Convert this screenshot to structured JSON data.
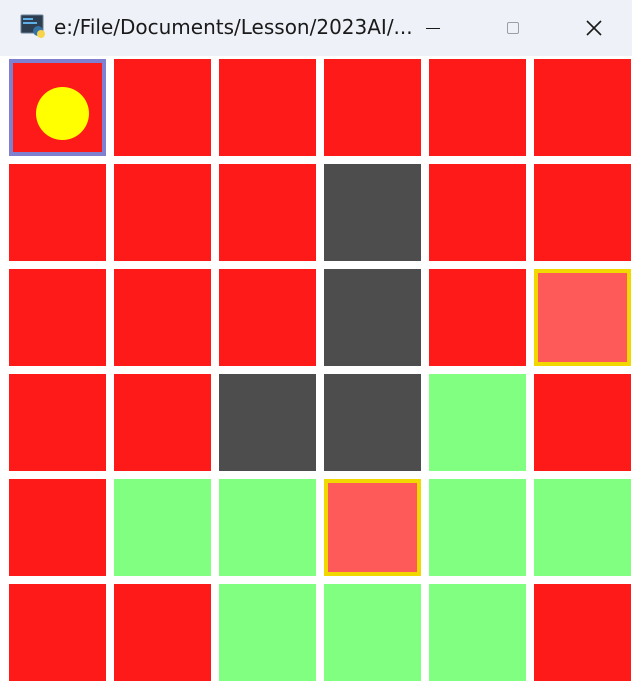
{
  "window": {
    "title": "e:/File/Documents/Lesson/2023AI/..."
  },
  "titlebar_icons": {
    "app": "python-app-icon",
    "minimize": "minimize-icon",
    "maximize": "maximize-icon",
    "close": "close-icon"
  },
  "legend": {
    "R": {
      "type": "red",
      "color": "#ff1a1a"
    },
    "W": {
      "type": "wall",
      "color": "#4d4d4d"
    },
    "G": {
      "type": "goal-region",
      "color": "#80ff80"
    },
    "T": {
      "type": "highlighted",
      "color": "#ff5a5a",
      "border": "#f0d800"
    }
  },
  "grid": {
    "rows": 6,
    "cols": 6,
    "cells": [
      [
        "R",
        "R",
        "R",
        "R",
        "R",
        "R"
      ],
      [
        "R",
        "R",
        "R",
        "W",
        "R",
        "R"
      ],
      [
        "R",
        "R",
        "R",
        "W",
        "R",
        "T"
      ],
      [
        "R",
        "R",
        "W",
        "W",
        "G",
        "R"
      ],
      [
        "R",
        "G",
        "G",
        "T",
        "G",
        "G"
      ],
      [
        "R",
        "R",
        "G",
        "G",
        "G",
        "R"
      ]
    ],
    "selected": {
      "row": 0,
      "col": 0,
      "border_color": "#8080d0"
    },
    "agent": {
      "row": 0,
      "col": 0,
      "color": "#ffff00",
      "icon": "agent-circle-icon"
    }
  }
}
